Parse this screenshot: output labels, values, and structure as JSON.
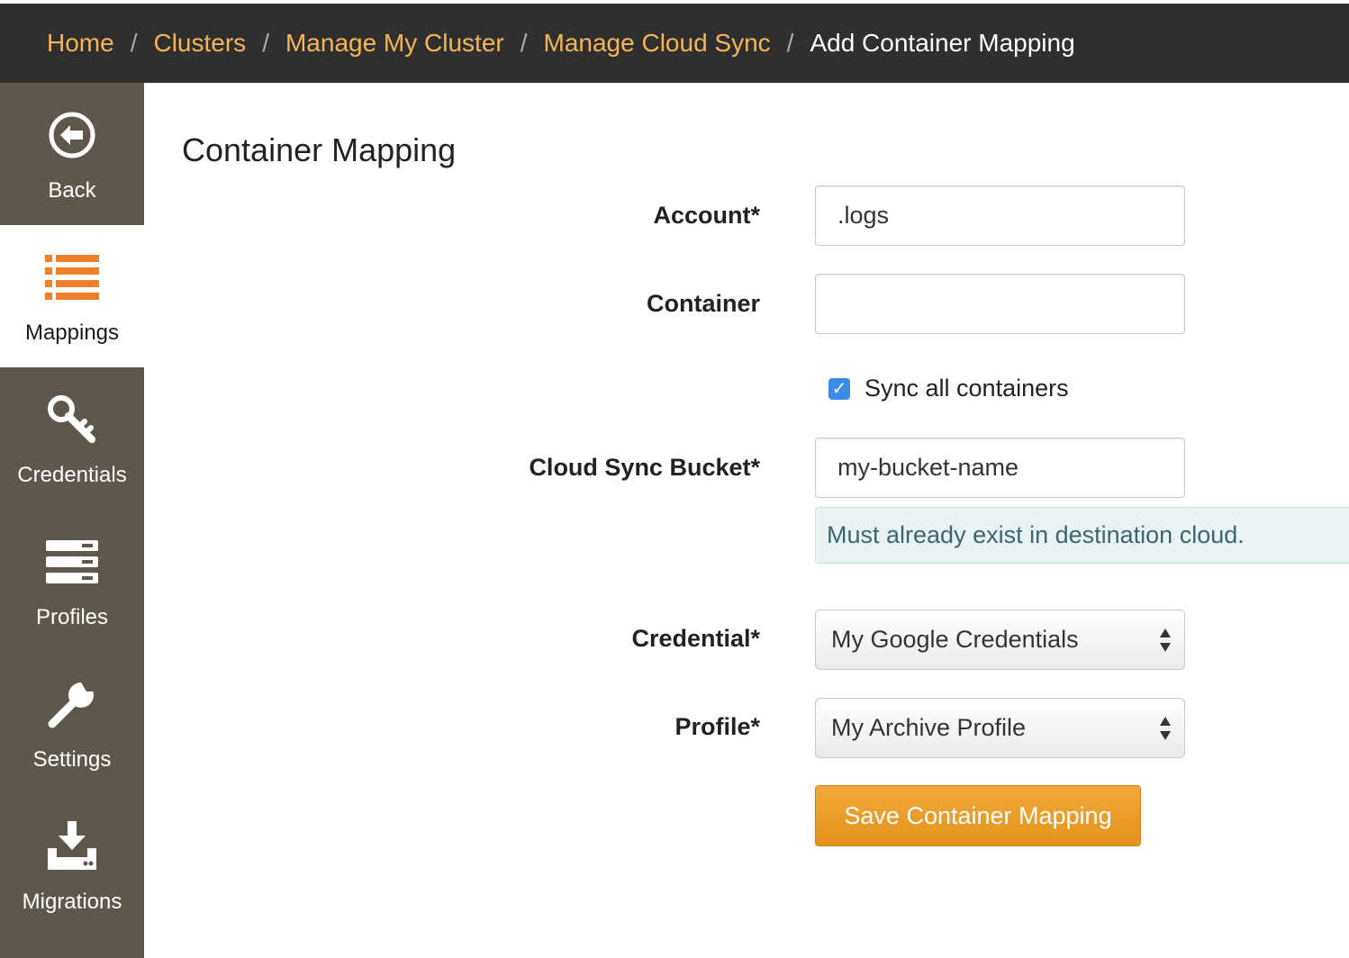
{
  "breadcrumb": {
    "items": [
      "Home",
      "Clusters",
      "Manage My Cluster",
      "Manage Cloud Sync"
    ],
    "separator": "/",
    "current": "Add Container Mapping"
  },
  "sidebar": {
    "items": [
      {
        "label": "Back",
        "icon": "back-arrow-circle-icon",
        "active": false
      },
      {
        "label": "Mappings",
        "icon": "list-icon",
        "active": true
      },
      {
        "label": "Credentials",
        "icon": "key-icon",
        "active": false
      },
      {
        "label": "Profiles",
        "icon": "server-stack-icon",
        "active": false
      },
      {
        "label": "Settings",
        "icon": "wrench-icon",
        "active": false
      },
      {
        "label": "Migrations",
        "icon": "download-tray-icon",
        "active": false
      }
    ]
  },
  "form": {
    "title": "Container Mapping",
    "account": {
      "label": "Account*",
      "value": ".logs"
    },
    "container": {
      "label": "Container",
      "value": ""
    },
    "sync_all": {
      "label": "Sync all containers",
      "checked": true
    },
    "bucket": {
      "label": "Cloud Sync Bucket*",
      "value": "my-bucket-name",
      "help": "Must already exist in destination cloud."
    },
    "credential": {
      "label": "Credential*",
      "selected": "My Google Credentials"
    },
    "profile": {
      "label": "Profile*",
      "selected": "My Archive Profile"
    },
    "save_label": "Save Container Mapping"
  },
  "colors": {
    "topbar": "#2f2f2f",
    "breadcrumb_link": "#f5b556",
    "sidebar": "#5f574c",
    "accent_orange": "#f0802b",
    "checkbox": "#3b8ce8",
    "help_bg": "#eaf3f3",
    "save_button": "#eb9d2a"
  }
}
